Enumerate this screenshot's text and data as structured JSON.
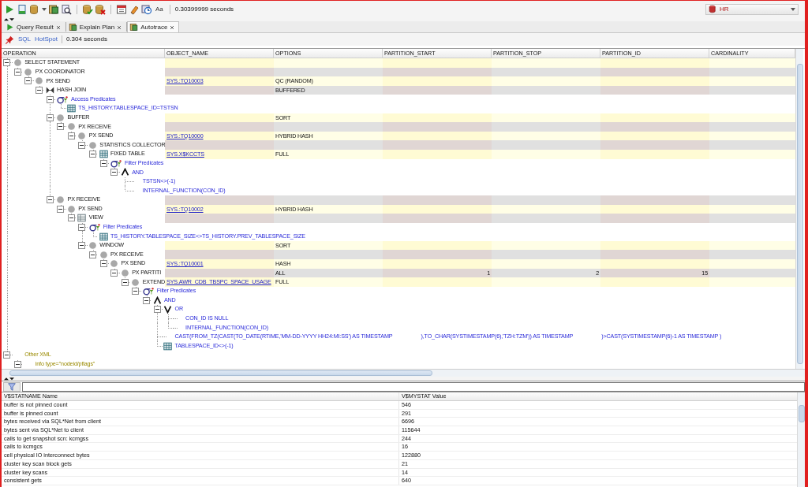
{
  "toolbar": {
    "format_label": "Aa",
    "elapsed": "0.30399999 seconds",
    "connection": "HR"
  },
  "tabs": [
    {
      "label": "Query Result",
      "selected": false
    },
    {
      "label": "Explain Plan",
      "selected": false
    },
    {
      "label": "Autotrace",
      "selected": true
    }
  ],
  "subbar": {
    "links": [
      "SQL",
      "HotSpot"
    ],
    "elapsed": "0.304 seconds"
  },
  "plan": {
    "columns": [
      "OPERATION",
      "OBJECT_NAME",
      "OPTIONS",
      "PARTITION_START",
      "PARTITION_STOP",
      "PARTITION_ID",
      "CARDINALITY"
    ],
    "rows": [
      {
        "kind": "operation",
        "operation": "SELECT STATEMENT",
        "expanded": true,
        "children": [
          {
            "kind": "operation",
            "operation": "PX COORDINATOR",
            "expanded": true,
            "children": [
              {
                "kind": "operation",
                "operation": "PX SEND",
                "object_name": "SYS.:TQ10003",
                "options": "QC (RANDOM)",
                "expanded": true,
                "children": [
                  {
                    "kind": "join",
                    "operation": "HASH JOIN",
                    "options": "BUFFERED",
                    "expanded": true,
                    "children": [
                      {
                        "kind": "filter",
                        "operation": "Access Predicates",
                        "expanded": true,
                        "children": [
                          {
                            "kind": "condition-table",
                            "operation": "TS_HISTORY.TABLESPACE_ID=TSTSN"
                          }
                        ]
                      },
                      {
                        "kind": "operation",
                        "operation": "BUFFER",
                        "options": "SORT",
                        "expanded": true,
                        "children": [
                          {
                            "kind": "operation",
                            "operation": "PX RECEIVE",
                            "expanded": true,
                            "children": [
                              {
                                "kind": "operation",
                                "operation": "PX SEND",
                                "object_name": "SYS.:TQ10000",
                                "options": "HYBRID HASH",
                                "expanded": true,
                                "children": [
                                  {
                                    "kind": "operation",
                                    "operation": "STATISTICS COLLECTOR",
                                    "expanded": true,
                                    "children": [
                                      {
                                        "kind": "table",
                                        "operation": "FIXED TABLE",
                                        "object_name": "SYS.X$KCCTS",
                                        "options": "FULL",
                                        "expanded": true,
                                        "children": [
                                          {
                                            "kind": "filter",
                                            "operation": "Filter Predicates",
                                            "expanded": true,
                                            "children": [
                                              {
                                                "kind": "and",
                                                "operation": "AND",
                                                "expanded": true,
                                                "children": [
                                                  {
                                                    "kind": "condition",
                                                    "operation": "TSTSN<>(-1)"
                                                  },
                                                  {
                                                    "kind": "condition",
                                                    "operation": "INTERNAL_FUNCTION(CON_ID)"
                                                  }
                                                ]
                                              }
                                            ]
                                          }
                                        ]
                                      }
                                    ]
                                  }
                                ]
                              }
                            ]
                          }
                        ]
                      },
                      {
                        "kind": "operation",
                        "operation": "PX RECEIVE",
                        "expanded": true,
                        "children": [
                          {
                            "kind": "operation",
                            "operation": "PX SEND",
                            "object_name": "SYS.:TQ10002",
                            "options": "HYBRID HASH",
                            "expanded": true,
                            "children": [
                              {
                                "kind": "view",
                                "operation": "VIEW",
                                "expanded": true,
                                "children": [
                                  {
                                    "kind": "filter",
                                    "operation": "Filter Predicates",
                                    "expanded": true,
                                    "children": [
                                      {
                                        "kind": "condition-table",
                                        "operation": "TS_HISTORY.TABLESPACE_SIZE<>TS_HISTORY.PREV_TABLESPACE_SIZE"
                                      }
                                    ]
                                  },
                                  {
                                    "kind": "operation",
                                    "operation": "WINDOW",
                                    "options": "SORT",
                                    "expanded": true,
                                    "children": [
                                      {
                                        "kind": "operation",
                                        "operation": "PX RECEIVE",
                                        "expanded": true,
                                        "children": [
                                          {
                                            "kind": "operation",
                                            "operation": "PX SEND",
                                            "object_name": "SYS.:TQ10001",
                                            "options": "HASH",
                                            "expanded": true,
                                            "children": [
                                              {
                                                "kind": "operation",
                                                "operation": "PX PARTITI",
                                                "options": "ALL",
                                                "partition_start": "1",
                                                "partition_stop": "2",
                                                "partition_id": "15",
                                                "expanded": true,
                                                "children": [
                                                  {
                                                    "kind": "operation",
                                                    "operation": "EXTEND",
                                                    "object_name": "SYS.AWR_CDB_TBSPC_SPACE_USAGE",
                                                    "options": "FULL",
                                                    "expanded": true,
                                                    "children": [
                                                      {
                                                        "kind": "filter",
                                                        "operation": "Filter Predicates",
                                                        "expanded": true,
                                                        "children": [
                                                          {
                                                            "kind": "and",
                                                            "operation": "AND",
                                                            "expanded": true,
                                                            "children": [
                                                              {
                                                                "kind": "or",
                                                                "operation": "OR",
                                                                "expanded": true,
                                                                "children": [
                                                                  {
                                                                    "kind": "condition",
                                                                    "operation": "CON_ID IS NULL"
                                                                  },
                                                                  {
                                                                    "kind": "condition",
                                                                    "operation": "INTERNAL_FUNCTION(CON_ID)"
                                                                  }
                                                                ]
                                                              },
                                                              {
                                                                "kind": "condition",
                                                                "parts": [
                                                                  "CAST(FROM_TZ(CAST(TO_DATE(RTIME,'MM-DD-YYYY HH24:MI:SS') AS TIMESTAMP",
                                                                  "),TO_CHAR(SYSTIMESTAMP(6),'TZH:TZM')) AS TIMESTAMP",
                                                                  ")>CAST(SYSTIMESTAMP(6)-1 AS TIMESTAMP )"
                                                                ]
                                                              },
                                                              {
                                                                "kind": "condition-table",
                                                                "operation": "TABLESPACE_ID<>(-1)"
                                                              }
                                                            ]
                                                          }
                                                        ]
                                                      }
                                                    ]
                                                  }
                                                ]
                                              }
                                            ]
                                          }
                                        ]
                                      }
                                    ]
                                  }
                                ]
                              }
                            ]
                          }
                        ]
                      }
                    ]
                  }
                ]
              }
            ]
          }
        ]
      },
      {
        "kind": "xml",
        "operation": "Other XML",
        "expanded": true,
        "children": [
          {
            "kind": "xml",
            "operation": "info type=\"nodeid/pflags\"",
            "expanded": true
          }
        ]
      }
    ]
  },
  "stats": {
    "columns": [
      "V$STATNAME Name",
      "V$MYSTAT Value"
    ],
    "rows": [
      [
        "buffer is not pinned count",
        "546"
      ],
      [
        "buffer is pinned count",
        "291"
      ],
      [
        "bytes received via SQL*Net from client",
        "6696"
      ],
      [
        "bytes sent via SQL*Net to client",
        "115644"
      ],
      [
        "calls to get snapshot scn: kcmgss",
        "244"
      ],
      [
        "calls to kcmgcs",
        "16"
      ],
      [
        "cell physical IO interconnect bytes",
        "122880"
      ],
      [
        "cluster key scan block gets",
        "21"
      ],
      [
        "cluster key scans",
        "14"
      ],
      [
        "consistent gets",
        "640"
      ]
    ]
  }
}
